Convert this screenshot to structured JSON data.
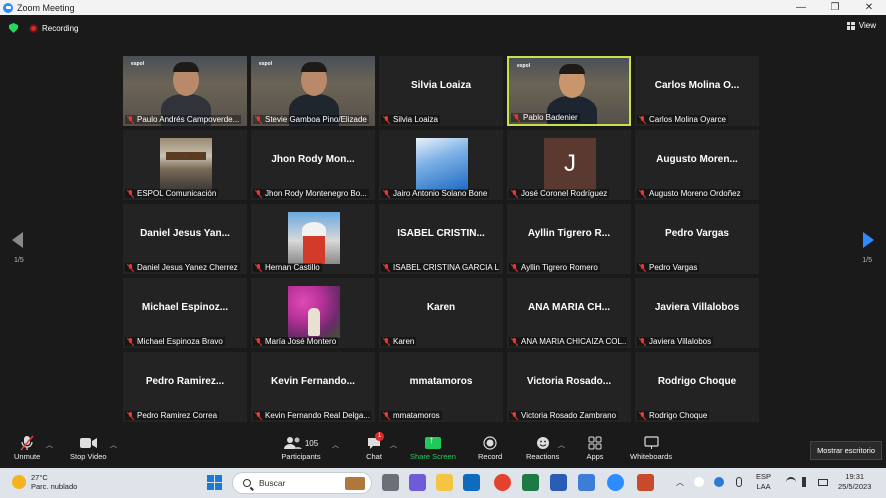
{
  "window": {
    "title": "Zoom Meeting",
    "controls": [
      "—",
      "❐",
      "✕"
    ]
  },
  "topbar": {
    "recording_label": "Recording",
    "view_label": "View"
  },
  "page_left": "1/5",
  "page_right": "1/5",
  "tiles": [
    {
      "type": "video",
      "label": "Paulo Andrés Campoverde..."
    },
    {
      "type": "video",
      "label": "Stevie Gamboa Pino/Elizade"
    },
    {
      "type": "name",
      "bigname": "Silvia Loaiza",
      "label": "Silvia Loaiza"
    },
    {
      "type": "video",
      "label": "Pablo Badenier",
      "active": true
    },
    {
      "type": "name",
      "bigname": "Carlos Molina O...",
      "label": "Carlos Molina Oyarce"
    },
    {
      "type": "picture",
      "label": "ESPOL Comunicación"
    },
    {
      "type": "name",
      "bigname": "Jhon Rody Mon...",
      "label": "Jhon Rody Montenegro Bo..."
    },
    {
      "type": "picture",
      "label": "Jairo Antonio Solano Bone"
    },
    {
      "type": "avatar",
      "initial": "J",
      "label": "José Coronel Rodríguez"
    },
    {
      "type": "name",
      "bigname": "Augusto Moren...",
      "label": "Augusto Moreno Ordoñez"
    },
    {
      "type": "name",
      "bigname": "Daniel Jesus Yan...",
      "label": "Daniel Jesus Yanez Cherrez"
    },
    {
      "type": "picture",
      "label": "Hernan Castillo"
    },
    {
      "type": "name",
      "bigname": "ISABEL CRISTIN...",
      "label": "ISABEL CRISTINA GARCIA L..."
    },
    {
      "type": "name",
      "bigname": "Ayllin Tigrero R...",
      "label": "Ayllin Tigrero Romero"
    },
    {
      "type": "name",
      "bigname": "Pedro Vargas",
      "label": "Pedro Vargas"
    },
    {
      "type": "name",
      "bigname": "Michael Espinoz...",
      "label": "Michael Espinoza Bravo"
    },
    {
      "type": "picture",
      "label": "María José Montero"
    },
    {
      "type": "name",
      "bigname": "Karen",
      "label": "Karen"
    },
    {
      "type": "name",
      "bigname": "ANA MARIA CH...",
      "label": "ANA MARIA CHICAIZA COL..."
    },
    {
      "type": "name",
      "bigname": "Javiera Villalobos",
      "label": "Javiera Villalobos"
    },
    {
      "type": "name",
      "bigname": "Pedro Ramirez...",
      "label": "Pedro Ramirez Correa"
    },
    {
      "type": "name",
      "bigname": "Kevin Fernando...",
      "label": "Kevin Fernando Real Delga..."
    },
    {
      "type": "name",
      "bigname": "mmatamoros",
      "label": "mmatamoros"
    },
    {
      "type": "name",
      "bigname": "Victoria Rosado...",
      "label": "Victoria Rosado Zambrano"
    },
    {
      "type": "name",
      "bigname": "Rodrigo Choque",
      "label": "Rodrigo Choque"
    }
  ],
  "espol_logo_text": "espol",
  "toolbar": {
    "unmute": "Unmute",
    "stop_video": "Stop Video",
    "participants": "Participants",
    "participants_count": "105",
    "chat": "Chat",
    "chat_badge": "1",
    "share_screen": "Share Screen",
    "record": "Record",
    "reactions": "Reactions",
    "apps": "Apps",
    "whiteboards": "Whiteboards",
    "show_desktop": "Mostrar escritorio"
  },
  "taskbar": {
    "temperature": "27°C",
    "weather": "Parc. nublado",
    "search_placeholder": "Buscar",
    "lang_top": "ESP",
    "lang_bottom": "LAA",
    "time": "19:31",
    "date": "25/5/2023"
  },
  "colors": {
    "zoom_blue": "#2d8cff",
    "active_speaker": "#c8e04a",
    "share_green": "#23c85a",
    "muted_red": "#e03a3a"
  }
}
